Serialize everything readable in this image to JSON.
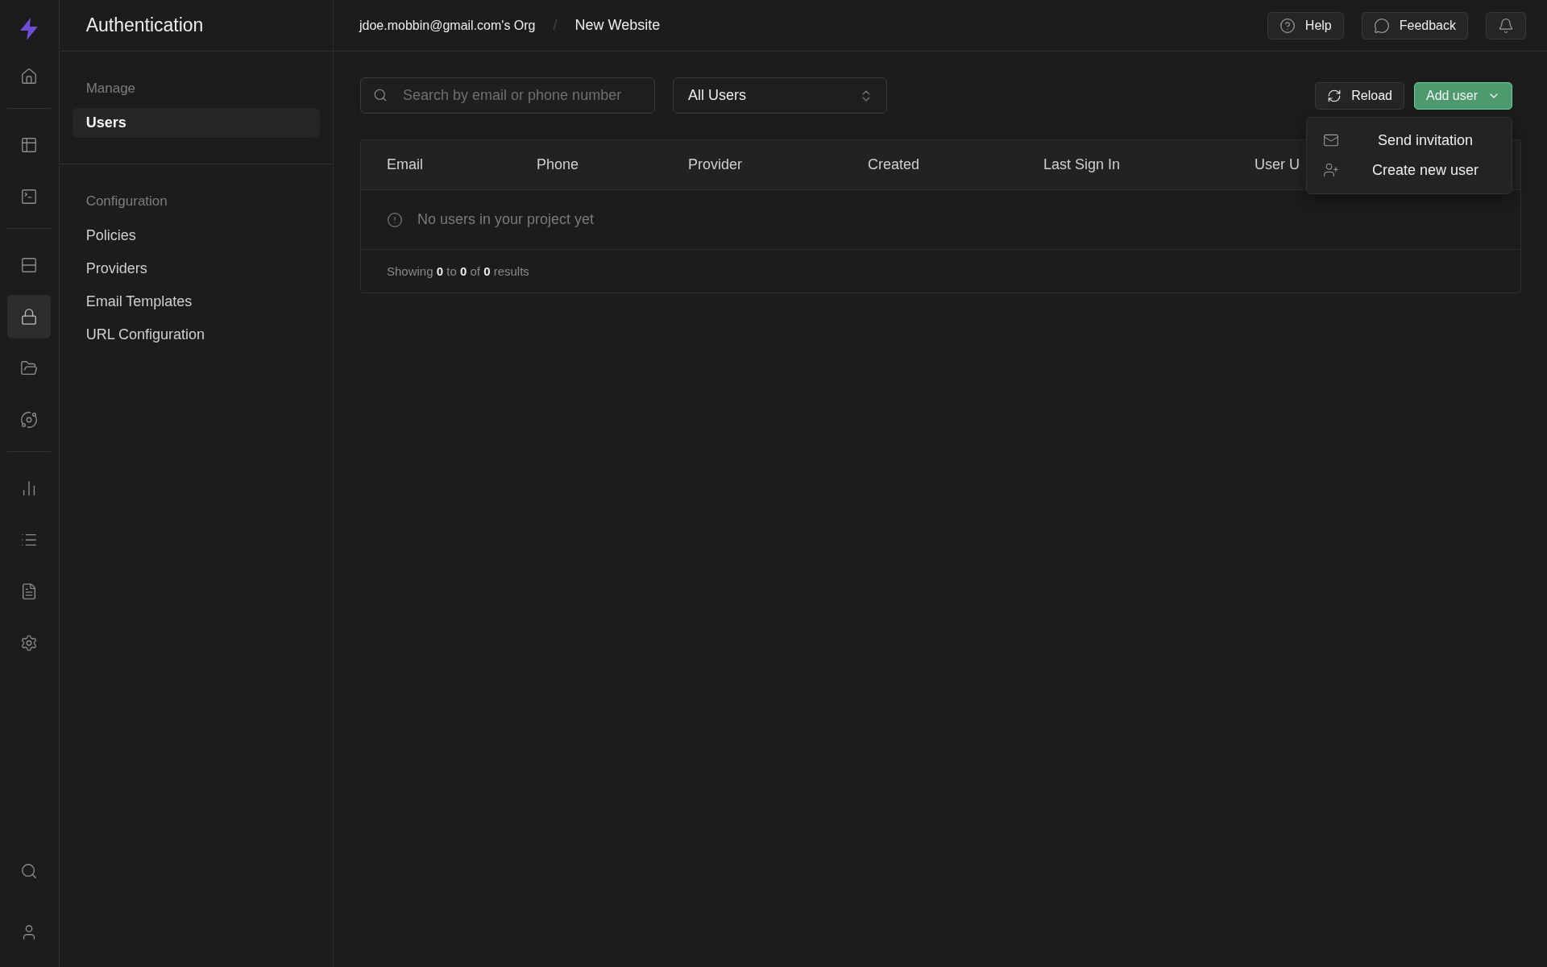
{
  "rail": {
    "groups": [
      [
        {
          "selected": false
        }
      ],
      [
        {
          "selected": false
        },
        {
          "selected": false
        }
      ],
      [
        {
          "selected": false
        },
        {
          "selected": true
        },
        {
          "selected": false
        },
        {
          "selected": false
        }
      ],
      [
        {
          "selected": false
        },
        {
          "selected": false
        },
        {
          "selected": false
        },
        {
          "selected": false
        }
      ]
    ]
  },
  "sidebar": {
    "title": "Authentication",
    "sections": [
      {
        "heading": "Manage",
        "items": [
          {
            "label": "Users",
            "selected": true
          }
        ]
      },
      {
        "heading": "Configuration",
        "items": [
          {
            "label": "Policies",
            "selected": false
          },
          {
            "label": "Providers",
            "selected": false
          },
          {
            "label": "Email Templates",
            "selected": false
          },
          {
            "label": "URL Configuration",
            "selected": false
          }
        ]
      }
    ]
  },
  "breadcrumbs": [
    {
      "label": "jdoe.mobbin@gmail.com's Org"
    },
    {
      "label": "New Website"
    }
  ],
  "breadcrumb_separator": "/",
  "top_buttons": [
    {
      "kind": "help",
      "label": "Help"
    },
    {
      "kind": "feedback",
      "label": "Feedback"
    },
    {
      "kind": "bell"
    }
  ],
  "search": {
    "placeholder": "Search by email or phone number"
  },
  "filter": {
    "value": "All Users"
  },
  "reload_button": "Reload",
  "add_user_button": {
    "label": "Add user",
    "expanded": true
  },
  "menu": [
    {
      "kind": "mail",
      "label": "Send invitation"
    },
    {
      "kind": "user-plus",
      "label": "Create new user"
    }
  ],
  "table": {
    "columns": [
      "Email",
      "Phone",
      "Provider",
      "Created",
      "Last Sign In",
      "User U"
    ],
    "empty_message": "No users in your project yet",
    "footer": "Showing **0** to **0** of **0** results"
  }
}
